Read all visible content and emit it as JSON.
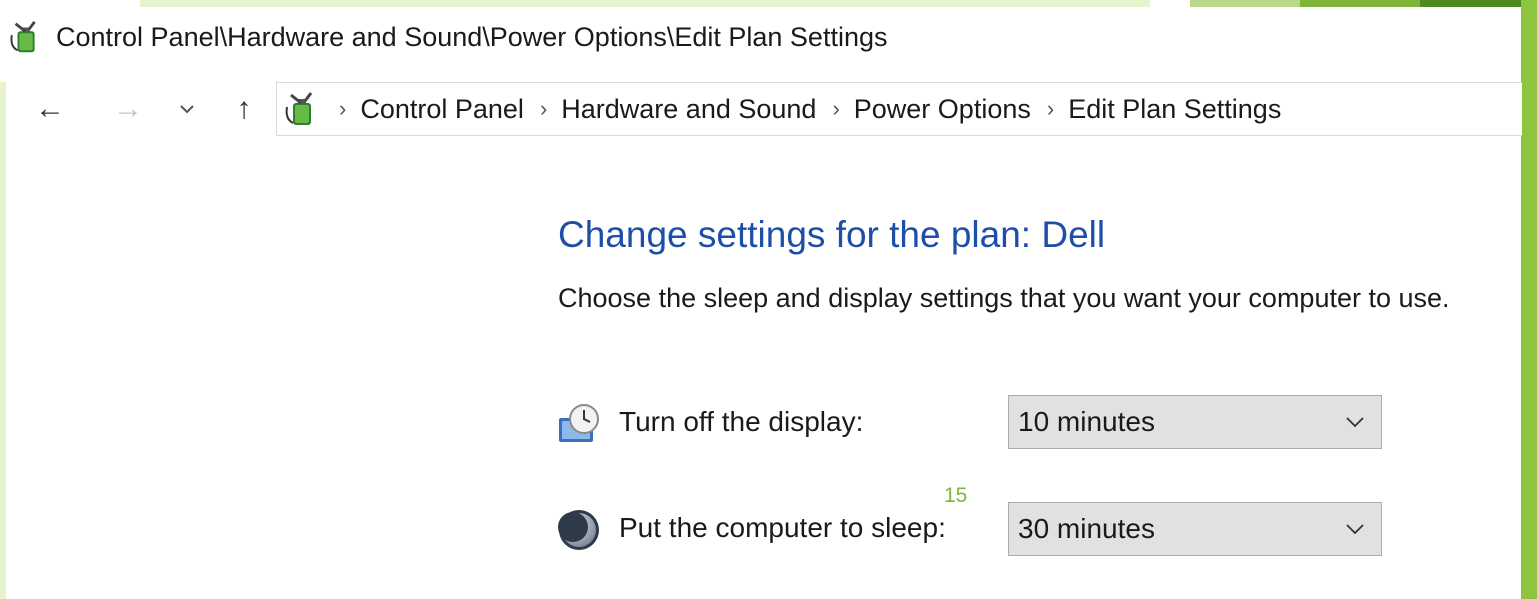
{
  "window": {
    "title": "Control Panel\\Hardware and Sound\\Power Options\\Edit Plan Settings"
  },
  "nav": {
    "back_glyph": "←",
    "forward_glyph": "→",
    "recent_glyph": "⌄",
    "up_glyph": "↑",
    "icon": "power-plug-battery-icon"
  },
  "breadcrumb": {
    "separator": "›",
    "items": [
      "Control Panel",
      "Hardware and Sound",
      "Power Options",
      "Edit Plan Settings"
    ]
  },
  "main": {
    "heading": "Change settings for the plan: Dell",
    "description": "Choose the sleep and display settings that you want your computer to use."
  },
  "settings": {
    "display": {
      "label": "Turn off the display:",
      "value": "10 minutes",
      "icon": "display-clock-icon"
    },
    "sleep": {
      "label": "Put the computer to sleep:",
      "value": "30 minutes",
      "icon": "moon-sleep-icon"
    }
  },
  "annotation": {
    "text": "15"
  },
  "colors": {
    "heading": "#1e4fa8",
    "accent_green": "#8cc63f",
    "dropdown_bg": "#e1e1e1"
  }
}
